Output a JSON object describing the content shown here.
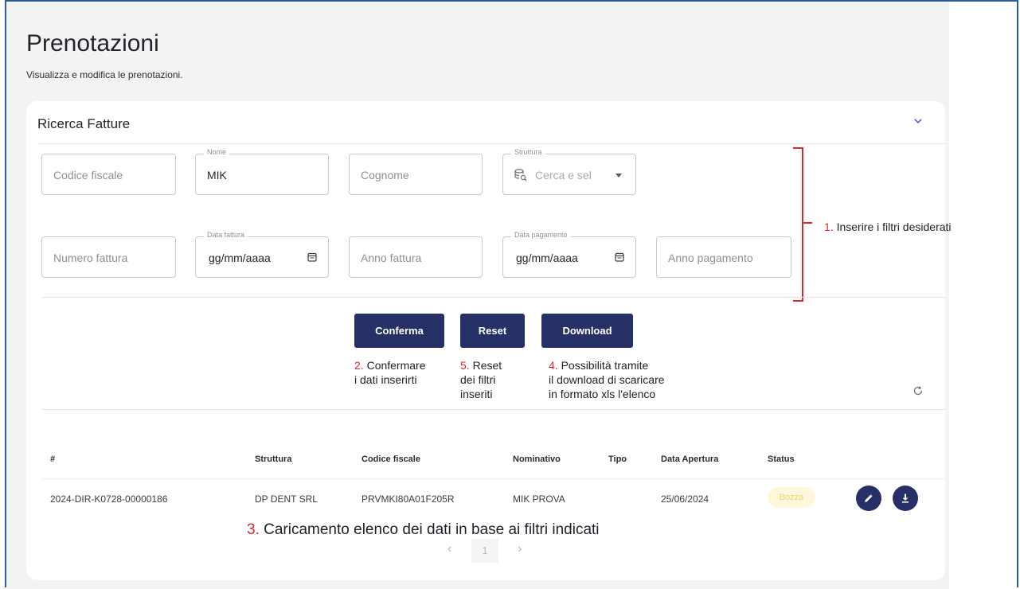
{
  "page": {
    "title": "Prenotazioni",
    "subtitle": "Visualizza e modifica le prenotazioni."
  },
  "search_card": {
    "title": "Ricerca Fatture",
    "fields": {
      "codice_fiscale": {
        "placeholder": "Codice fiscale"
      },
      "nome": {
        "label": "Nome",
        "value": "MIK"
      },
      "cognome": {
        "placeholder": "Cognome"
      },
      "struttura": {
        "label": "Struttura",
        "placeholder": "Cerca e sel"
      },
      "numero_fattura": {
        "placeholder": "Numero fattura"
      },
      "data_fattura": {
        "label": "Data fattura",
        "value": "gg/mm/aaaa"
      },
      "anno_fattura": {
        "placeholder": "Anno fattura"
      },
      "data_pagamento": {
        "label": "Data pagamento",
        "value": "gg/mm/aaaa"
      },
      "anno_pagamento": {
        "placeholder": "Anno pagamento"
      }
    },
    "buttons": {
      "conferma": "Conferma",
      "reset": "Reset",
      "download": "Download"
    }
  },
  "annotations": {
    "step1": {
      "num": "1.",
      "text": " Inserire i filtri desiderati"
    },
    "step2": {
      "num": "2.",
      "line1": " Confermare",
      "line2": "i dati inserirti"
    },
    "step5": {
      "num": "5.",
      "line1": " Reset",
      "line2": "dei filtri",
      "line3": "inseriti"
    },
    "step4": {
      "num": "4.",
      "line1": " Possibilità tramite",
      "line2": "il download di scaricare",
      "line3": "in formato xls l'elenco"
    },
    "step3": {
      "num": "3.",
      "text": " Caricamento elenco dei dati in base ai filtri indicati"
    }
  },
  "table": {
    "headers": [
      "#",
      "Struttura",
      "Codice fiscale",
      "Nominativo",
      "Tipo",
      "Data Apertura",
      "Status"
    ],
    "rows": [
      {
        "id": "2024-DIR-K0728-00000186",
        "struttura": "DP DENT SRL",
        "codice_fiscale": "PRVMKI80A01F205R",
        "nominativo": "MIK PROVA",
        "tipo": "",
        "data_apertura": "25/06/2024",
        "status": "Bozza"
      }
    ]
  },
  "pagination": {
    "prev": "‹",
    "current": "1",
    "next": "›"
  },
  "icons": {
    "chevron": "chevron-down-icon",
    "calendar": "calendar-icon",
    "database_search": "database-search-icon",
    "refresh": "refresh-icon",
    "edit": "pencil-icon",
    "download": "download-icon"
  },
  "colors": {
    "primary": "#263066",
    "annotation_red": "#d7282f",
    "accent_purple": "#7b4fc9",
    "badge_bg": "#fff7da",
    "badge_text": "#f0d27a"
  }
}
